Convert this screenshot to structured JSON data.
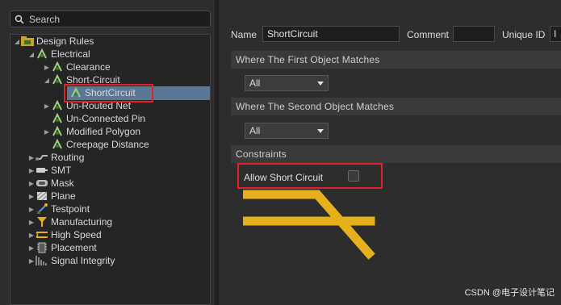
{
  "search": {
    "placeholder": "Search"
  },
  "tree": {
    "root": "Design Rules",
    "electrical": "Electrical",
    "clearance": "Clearance",
    "short_circuit": "Short-Circuit",
    "short_circuit_rule": "ShortCircuit",
    "unrouted_net": "Un-Routed Net",
    "unconnected_pin": "Un-Connected Pin",
    "modified_polygon": "Modified Polygon",
    "creepage": "Creepage Distance",
    "routing": "Routing",
    "smt": "SMT",
    "mask": "Mask",
    "plane": "Plane",
    "testpoint": "Testpoint",
    "manufacturing": "Manufacturing",
    "high_speed": "High Speed",
    "placement": "Placement",
    "signal_integrity": "Signal Integrity"
  },
  "rule": {
    "name_label": "Name",
    "name_value": "ShortCircuit",
    "comment_label": "Comment",
    "comment_value": "",
    "uid_label": "Unique ID",
    "uid_value": "I",
    "first_object_header": "Where The First Object Matches",
    "first_object_value": "All",
    "second_object_header": "Where The Second Object Matches",
    "second_object_value": "All",
    "constraints_header": "Constraints",
    "allow_short_circuit_label": "Allow Short Circuit",
    "allow_short_circuit_checked": false
  },
  "watermark": "CSDN @电子设计笔记",
  "colors": {
    "highlight": "#e1202a",
    "selection": "#5a7896",
    "track": "#e5b01c"
  }
}
